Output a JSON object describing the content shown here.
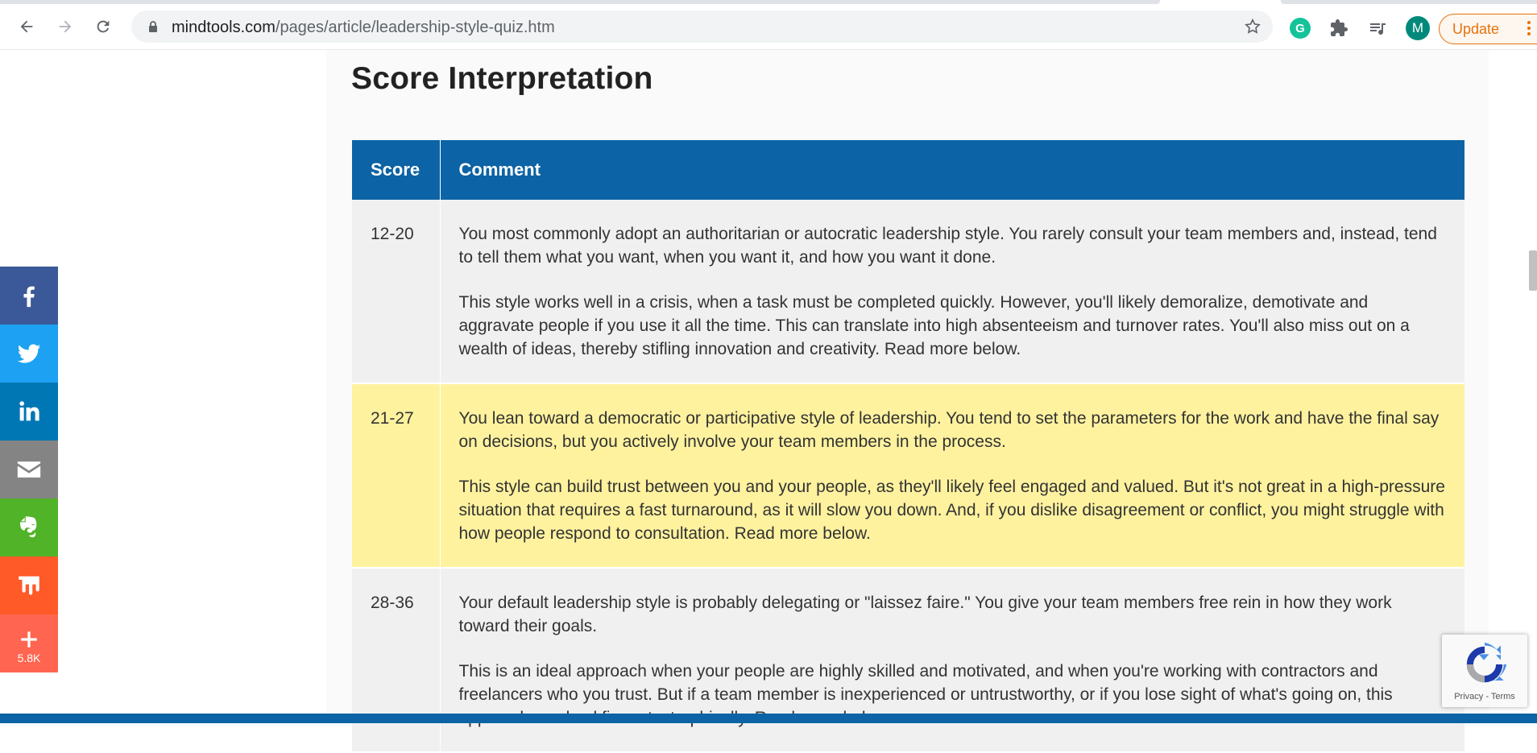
{
  "browser": {
    "url_domain": "mindtools.com",
    "url_path": "/pages/article/leadership-style-quiz.htm",
    "avatar_letter": "M",
    "grammarly_letter": "G",
    "update_label": "Update"
  },
  "page": {
    "heading": "Score Interpretation",
    "table": {
      "headers": {
        "score": "Score",
        "comment": "Comment"
      },
      "rows": [
        {
          "score": "12-20",
          "p1": "You most commonly adopt an authoritarian or autocratic leadership style. You rarely consult your team members and, instead, tend to tell them what you want, when you want it, and how you want it done.",
          "p2": "This style works well in a crisis, when a task must be completed quickly. However, you'll likely demoralize, demotivate and aggravate people if you use it all the time. This can translate into high absenteeism and turnover rates. You'll also miss out on a wealth of ideas, thereby stifling innovation and creativity. Read more below."
        },
        {
          "score": "21-27",
          "p1": "You lean toward a democratic or participative style of leadership. You tend to set the parameters for the work and have the final say on decisions, but you actively involve your team members in the process.",
          "p2": "This style can build trust between you and your people, as they'll likely feel engaged and valued. But it's not great in a high-pressure situation that requires a fast turnaround, as it will slow you down. And, if you dislike disagreement or conflict, you might struggle with how people respond to consultation. Read more below."
        },
        {
          "score": "28-36",
          "p1": "Your default leadership style is probably delegating or \"laissez faire.\" You give your team members free rein in how they work toward their goals.",
          "p2": "This is an ideal approach when your people are highly skilled and motivated, and when you're working with contractors and freelancers who you trust. But if a team member is inexperienced or untrustworthy, or if you lose sight of what's going on, this approach can backfire catastrophically. Read more below."
        }
      ]
    }
  },
  "share": {
    "count": "5.8K",
    "colors": {
      "facebook": "#3b5998",
      "twitter": "#1da1f2",
      "linkedin": "#0077b5",
      "email": "#848484",
      "evernote": "#51b328",
      "mix": "#ff5a28",
      "more": "#ff6550"
    }
  },
  "recaptcha": {
    "privacy": "Privacy",
    "sep": " - ",
    "terms": "Terms"
  }
}
